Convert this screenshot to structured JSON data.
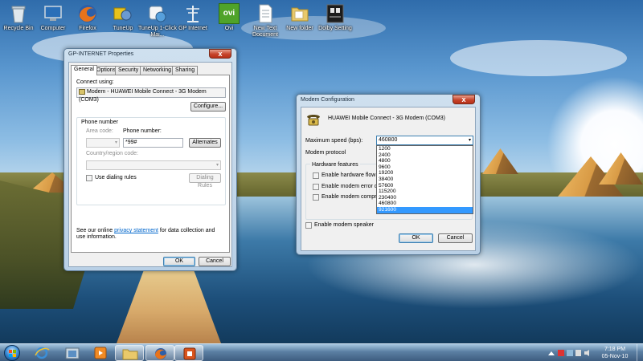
{
  "desktop": {
    "icons": [
      {
        "label": "Recycle Bin"
      },
      {
        "label": "Computer"
      },
      {
        "label": "Firefox"
      },
      {
        "label": "TuneUp"
      },
      {
        "label": "TuneUp 1-Click Mai..."
      },
      {
        "label": "GP Internet"
      },
      {
        "label": "Ovi"
      },
      {
        "label": "New Text Document"
      },
      {
        "label": "New folder"
      },
      {
        "label": "Dolby Setting"
      }
    ],
    "ovi_logo_text": "ovi"
  },
  "properties_window": {
    "title": "GP-INTERNET Properties",
    "close_glyph": "x",
    "tabs": [
      "General",
      "Options",
      "Security",
      "Networking",
      "Sharing"
    ],
    "active_tab": "General",
    "connect_using_label": "Connect using:",
    "device_name": "Modem - HUAWEI Mobile Connect - 3G Modem (COM3)",
    "configure_label": "Configure...",
    "phone_group_label": "Phone number",
    "area_code_label": "Area code:",
    "area_code_value": "",
    "phone_number_label": "Phone number:",
    "phone_number_value": "*99#",
    "alternates_label": "Alternates",
    "country_label": "Country/region code:",
    "country_value": "",
    "use_dialing_rules_label": "Use dialing rules",
    "use_dialing_rules_checked": false,
    "dialing_rules_label": "Dialing Rules",
    "privacy_text_before": "See our online ",
    "privacy_link": "privacy statement",
    "privacy_text_after": " for data collection and use information.",
    "ok_label": "OK",
    "cancel_label": "Cancel"
  },
  "modem_window": {
    "title": "Modem Configuration",
    "close_glyph": "x",
    "device_name": "HUAWEI Mobile Connect - 3G Modem (COM3)",
    "max_speed_label": "Maximum speed (bps):",
    "max_speed_value": "460800",
    "speed_options": [
      "1200",
      "2400",
      "4800",
      "9600",
      "19200",
      "38400",
      "57600",
      "115200",
      "230400",
      "460800",
      "921600"
    ],
    "highlighted_option": "921600",
    "modem_protocol_label": "Modem protocol",
    "hardware_features_label": "Hardware features",
    "feature_flow_label": "Enable hardware flow con",
    "feature_error_label": "Enable modem error contr",
    "feature_compress_label": "Enable modem compress",
    "speaker_label": "Enable modem speaker",
    "ok_label": "OK",
    "cancel_label": "Cancel"
  },
  "taskbar": {
    "time": "7:18 PM",
    "date": "05-Nov-10"
  },
  "colors": {
    "accent_blue": "#3399ff",
    "close_red": "#c6442b",
    "link": "#0066cc"
  }
}
